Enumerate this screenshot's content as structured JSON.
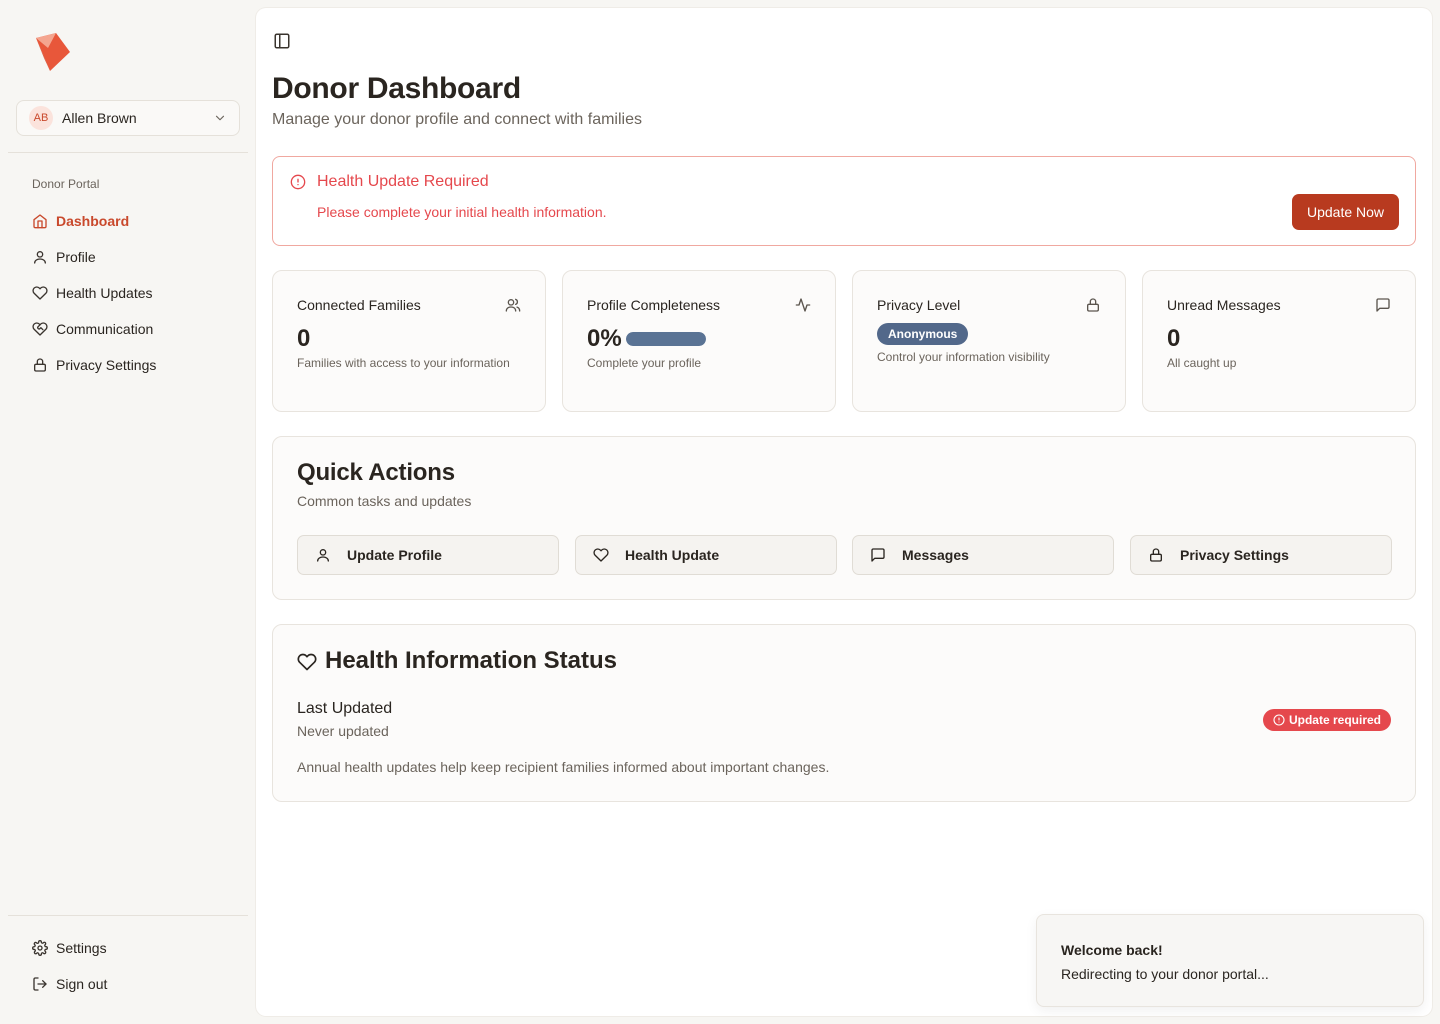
{
  "user": {
    "initials": "AB",
    "name": "Allen Brown"
  },
  "sidebar": {
    "group_label": "Donor Portal",
    "items": [
      {
        "label": "Dashboard",
        "icon": "home-icon",
        "active": true
      },
      {
        "label": "Profile",
        "icon": "user-icon"
      },
      {
        "label": "Health Updates",
        "icon": "heart-icon"
      },
      {
        "label": "Communication",
        "icon": "heart-handshake-icon"
      },
      {
        "label": "Privacy Settings",
        "icon": "lock-icon"
      }
    ],
    "bottom": [
      {
        "label": "Settings",
        "icon": "gear-icon"
      },
      {
        "label": "Sign out",
        "icon": "sign-out-icon"
      }
    ]
  },
  "header": {
    "title": "Donor Dashboard",
    "subtitle": "Manage your donor profile and connect with families"
  },
  "alert": {
    "title": "Health Update Required",
    "text": "Please complete your initial health information.",
    "button": "Update Now"
  },
  "stats": {
    "families": {
      "title": "Connected Families",
      "value": "0",
      "desc": "Families with access to your information"
    },
    "completeness": {
      "title": "Profile Completeness",
      "value": "0%",
      "desc": "Complete your profile",
      "progress": 0
    },
    "privacy": {
      "title": "Privacy Level",
      "badge": "Anonymous",
      "desc": "Control your information visibility"
    },
    "messages": {
      "title": "Unread Messages",
      "value": "0",
      "desc": "All caught up"
    }
  },
  "quick_actions": {
    "title": "Quick Actions",
    "subtitle": "Common tasks and updates",
    "buttons": [
      {
        "label": "Update Profile",
        "icon": "user-icon"
      },
      {
        "label": "Health Update",
        "icon": "heart-icon"
      },
      {
        "label": "Messages",
        "icon": "message-icon"
      },
      {
        "label": "Privacy Settings",
        "icon": "lock-icon"
      }
    ]
  },
  "health_status": {
    "title": "Health Information Status",
    "last_updated_label": "Last Updated",
    "last_updated_value": "Never updated",
    "badge": "Update required",
    "note": "Annual health updates help keep recipient families informed about important changes."
  },
  "toast": {
    "title": "Welcome back!",
    "text": "Redirecting to your donor portal..."
  },
  "colors": {
    "accent": "#c9492c",
    "primary_button": "#b83a1f",
    "danger": "#e5484d",
    "badge_slate": "#52688a"
  }
}
